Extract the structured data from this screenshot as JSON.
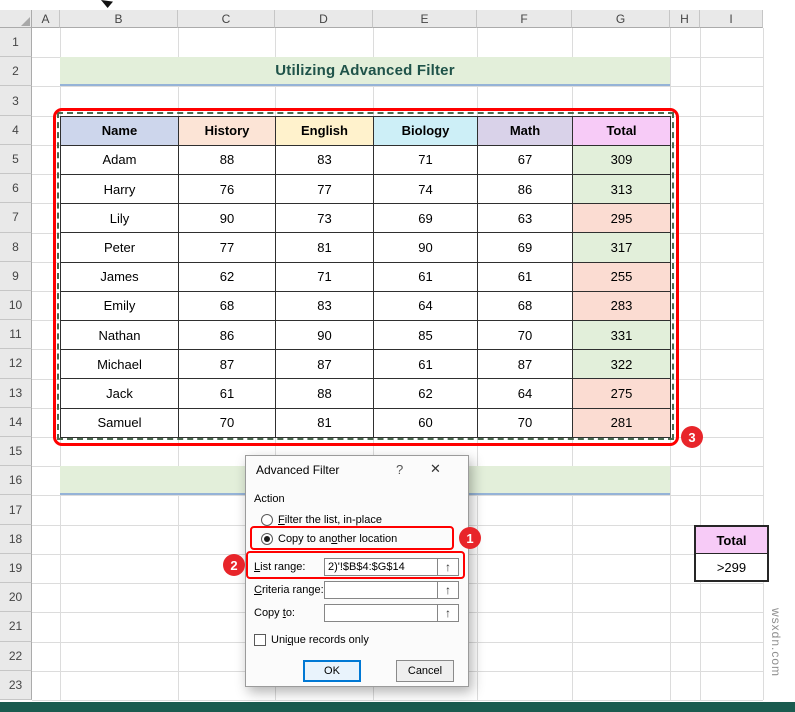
{
  "chrome": {
    "bottom_bar_color": "#1A5B4F",
    "watermark": "wsxdn.com"
  },
  "icons": {
    "range_selector": "↑"
  },
  "spreadsheet": {
    "column_headers": [
      "A",
      "B",
      "C",
      "D",
      "E",
      "F",
      "G",
      "H",
      "I"
    ],
    "row_headers": [
      "1",
      "2",
      "3",
      "4",
      "5",
      "6",
      "7",
      "8",
      "9",
      "10",
      "11",
      "12",
      "13",
      "14",
      "15",
      "16",
      "17",
      "18",
      "19",
      "20",
      "21",
      "22",
      "23"
    ],
    "title_banner": "Utilizing Advanced Filter",
    "banner_bg": "#E3EFDA",
    "banner_underline": "#95B3D7",
    "banner_text_color": "#1F5349"
  },
  "table": {
    "headers": [
      "Name",
      "History",
      "English",
      "Biology",
      "Math",
      "Total"
    ],
    "header_colors": [
      "#CDD6EC",
      "#FCE4D6",
      "#FFF2CC",
      "#CDEFF7",
      "#D9D2E9",
      "#F7CBF7"
    ],
    "total_colors": {
      "high": "#E2EFDA",
      "low": "#FBDCD2"
    },
    "rows": [
      {
        "name": "Adam",
        "scores": [
          88,
          83,
          71,
          67
        ],
        "total": 309,
        "total_status": "high"
      },
      {
        "name": "Harry",
        "scores": [
          76,
          77,
          74,
          86
        ],
        "total": 313,
        "total_status": "high"
      },
      {
        "name": "Lily",
        "scores": [
          90,
          73,
          69,
          63
        ],
        "total": 295,
        "total_status": "low"
      },
      {
        "name": "Peter",
        "scores": [
          77,
          81,
          90,
          69
        ],
        "total": 317,
        "total_status": "high"
      },
      {
        "name": "James",
        "scores": [
          62,
          71,
          61,
          61
        ],
        "total": 255,
        "total_status": "low"
      },
      {
        "name": "Emily",
        "scores": [
          68,
          83,
          64,
          68
        ],
        "total": 283,
        "total_status": "low"
      },
      {
        "name": "Nathan",
        "scores": [
          86,
          90,
          85,
          70
        ],
        "total": 331,
        "total_status": "high"
      },
      {
        "name": "Michael",
        "scores": [
          87,
          87,
          61,
          87
        ],
        "total": 322,
        "total_status": "high"
      },
      {
        "name": "Jack",
        "scores": [
          61,
          88,
          62,
          64
        ],
        "total": 275,
        "total_status": "low"
      },
      {
        "name": "Samuel",
        "scores": [
          70,
          81,
          60,
          70
        ],
        "total": 281,
        "total_status": "low"
      }
    ]
  },
  "criteria_box": {
    "header": "Total",
    "value": ">299",
    "header_color": "#F7CBF7"
  },
  "dialog": {
    "title": "Advanced Filter",
    "help_label": "?",
    "close_label": "✕",
    "action_label": "Action",
    "radios": [
      {
        "label": "Filter the list, in-place",
        "accel": 0,
        "selected": false
      },
      {
        "label": "Copy to another location",
        "accel": 10,
        "selected": true
      }
    ],
    "fields": [
      {
        "label": "List range:",
        "accel": 0,
        "value": "2)'!$B$4:$G$14"
      },
      {
        "label": "Criteria range:",
        "accel": 0,
        "value": ""
      },
      {
        "label": "Copy to:",
        "accel": 5,
        "value": ""
      }
    ],
    "checkbox": {
      "label": "Unique records only",
      "accel": 3
    },
    "ok_label": "OK",
    "cancel_label": "Cancel"
  },
  "annotations": {
    "box_color": "#FF0000",
    "badge_color": "#E8252A",
    "steps": [
      "1",
      "2",
      "3"
    ]
  }
}
